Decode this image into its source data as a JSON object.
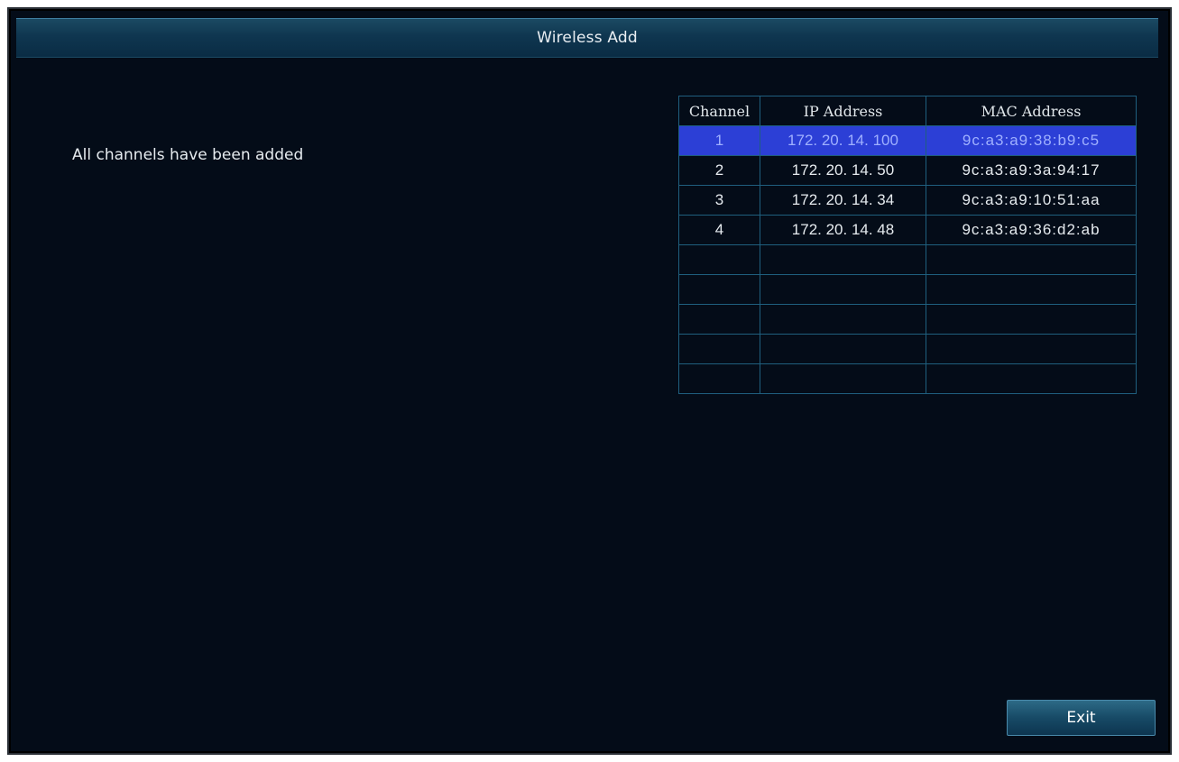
{
  "window": {
    "title": "Wireless Add"
  },
  "status_message": "All channels have been added",
  "table": {
    "columns": [
      "Channel",
      "IP Address",
      "MAC Address"
    ],
    "rows": [
      {
        "channel": "1",
        "ip": "172. 20. 14. 100",
        "mac": "9c:a3:a9:38:b9:c5",
        "selected": true
      },
      {
        "channel": "2",
        "ip": "172. 20. 14. 50",
        "mac": "9c:a3:a9:3a:94:17",
        "selected": false
      },
      {
        "channel": "3",
        "ip": "172. 20. 14. 34",
        "mac": "9c:a3:a9:10:51:aa",
        "selected": false
      },
      {
        "channel": "4",
        "ip": "172. 20. 14. 48",
        "mac": "9c:a3:a9:36:d2:ab",
        "selected": false
      },
      {
        "channel": "",
        "ip": "",
        "mac": "",
        "selected": false
      },
      {
        "channel": "",
        "ip": "",
        "mac": "",
        "selected": false
      },
      {
        "channel": "",
        "ip": "",
        "mac": "",
        "selected": false
      },
      {
        "channel": "",
        "ip": "",
        "mac": "",
        "selected": false
      },
      {
        "channel": "",
        "ip": "",
        "mac": "",
        "selected": false
      }
    ]
  },
  "buttons": {
    "exit_label": "Exit"
  },
  "colors": {
    "background": "#040c18",
    "titlebar": "#0f3650",
    "selected_row": "#2c3fd6",
    "grid_line": "#1f5f7e"
  }
}
